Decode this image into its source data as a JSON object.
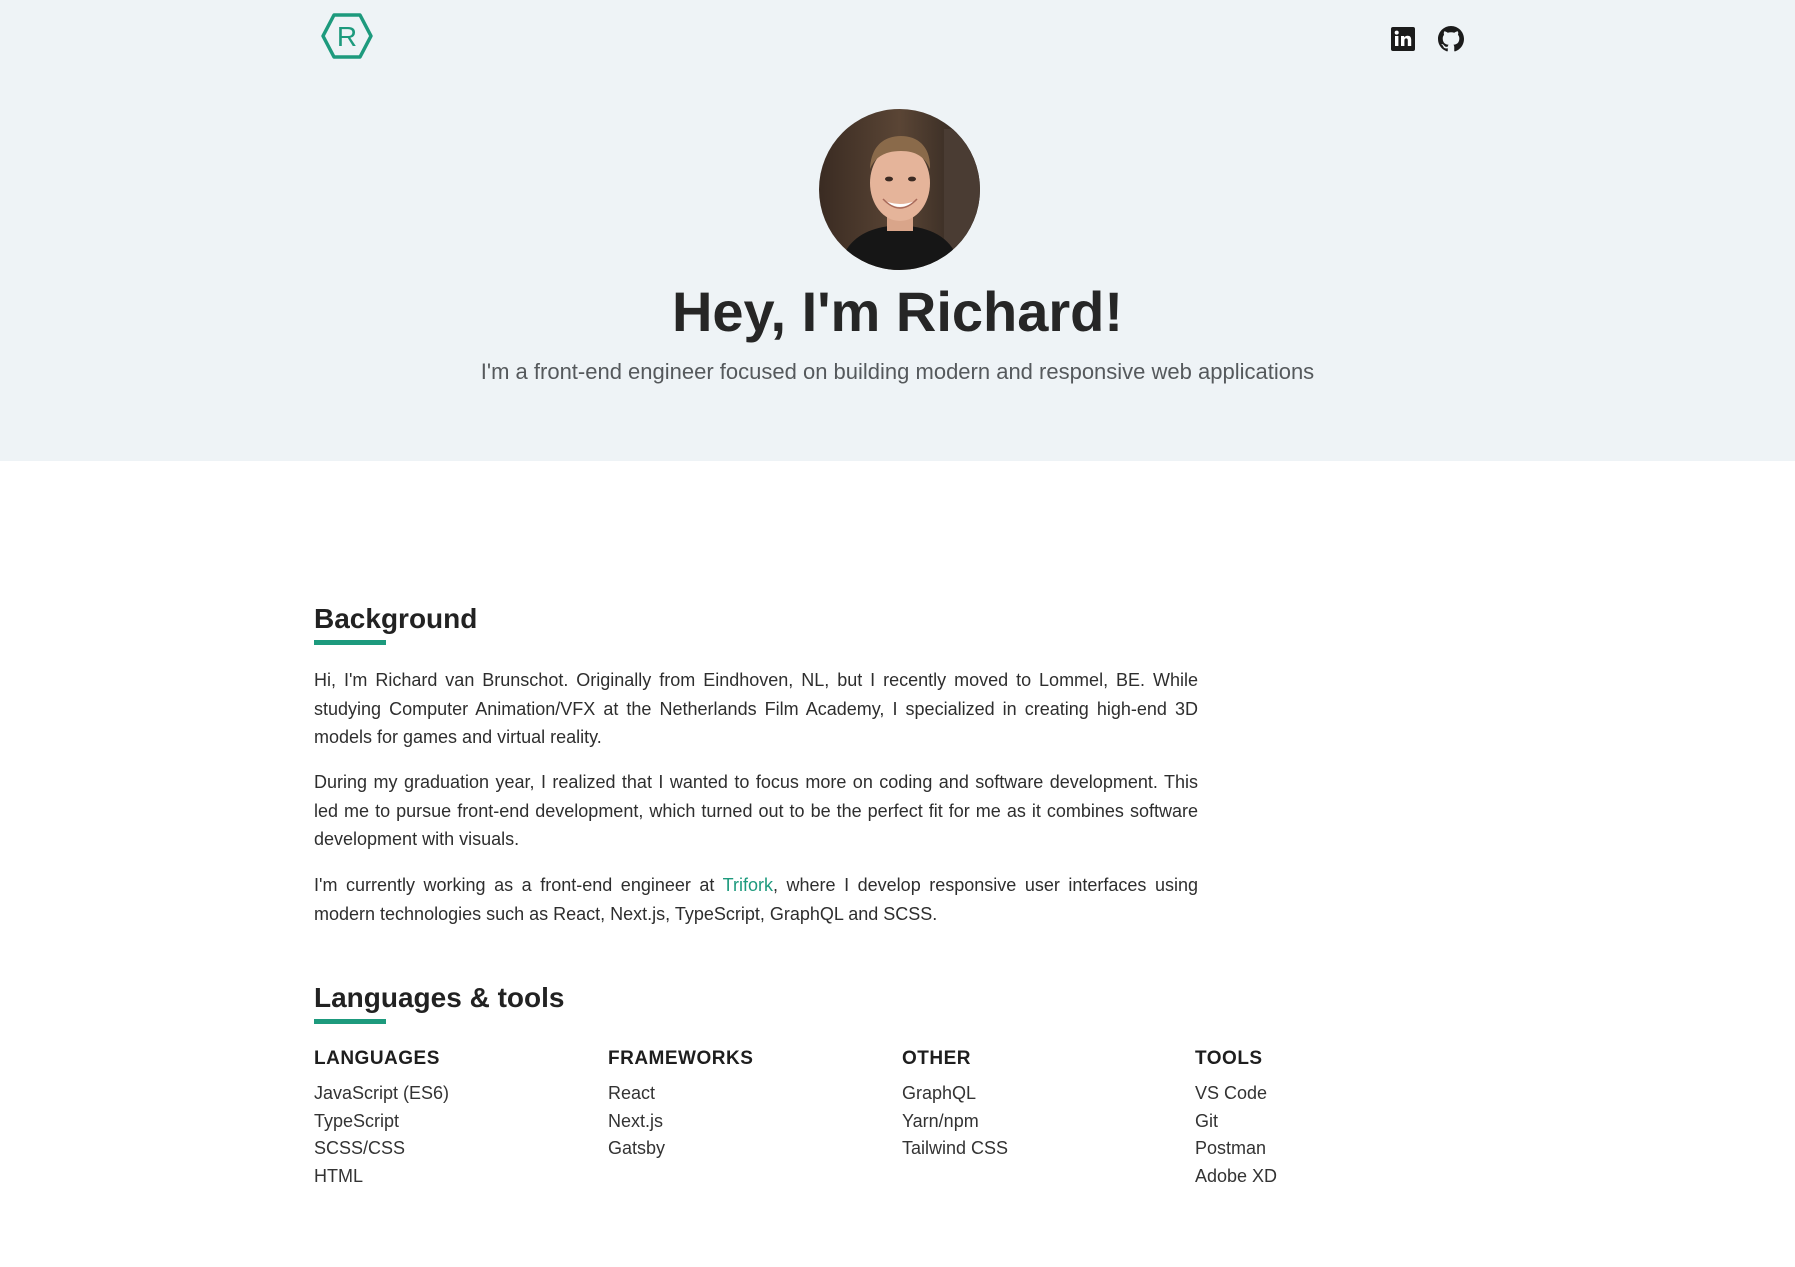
{
  "header": {
    "logo_letter": "R",
    "social": [
      {
        "name": "LinkedIn",
        "icon": "linkedin-icon"
      },
      {
        "name": "GitHub",
        "icon": "github-icon"
      }
    ]
  },
  "hero": {
    "title": "Hey, I'm Richard!",
    "subtitle": "I'm a front-end engineer focused on building modern and responsive web applications"
  },
  "background": {
    "title": "Background",
    "p1": "Hi, I'm Richard van Brunschot. Originally from Eindhoven, NL, but I recently moved to Lommel, BE. While studying Computer Animation/VFX at the Netherlands Film Academy, I specialized in creating high-end 3D models for games and virtual reality.",
    "p2": "During my graduation year, I realized that I wanted to focus more on coding and software development. This led me to pursue front-end development, which turned out to be the perfect fit for me as it combines software development with visuals.",
    "p3_before": "I'm currently working as a front-end engineer at ",
    "p3_link": "Trifork",
    "p3_after": ", where I develop responsive user interfaces using modern technologies such as React, Next.js, TypeScript, GraphQL and SCSS."
  },
  "tools": {
    "title": "Languages & tools",
    "columns": [
      {
        "heading": "LANGUAGES",
        "items": [
          "JavaScript (ES6)",
          "TypeScript",
          "SCSS/CSS",
          "HTML"
        ]
      },
      {
        "heading": "FRAMEWORKS",
        "items": [
          "React",
          "Next.js",
          "Gatsby"
        ]
      },
      {
        "heading": "OTHER",
        "items": [
          "GraphQL",
          "Yarn/npm",
          "Tailwind CSS"
        ]
      },
      {
        "heading": "TOOLS",
        "items": [
          "VS Code",
          "Git",
          "Postman",
          "Adobe XD"
        ]
      }
    ]
  },
  "colors": {
    "accent": "#1d9a7d",
    "hero_bg": "#eef3f6"
  }
}
